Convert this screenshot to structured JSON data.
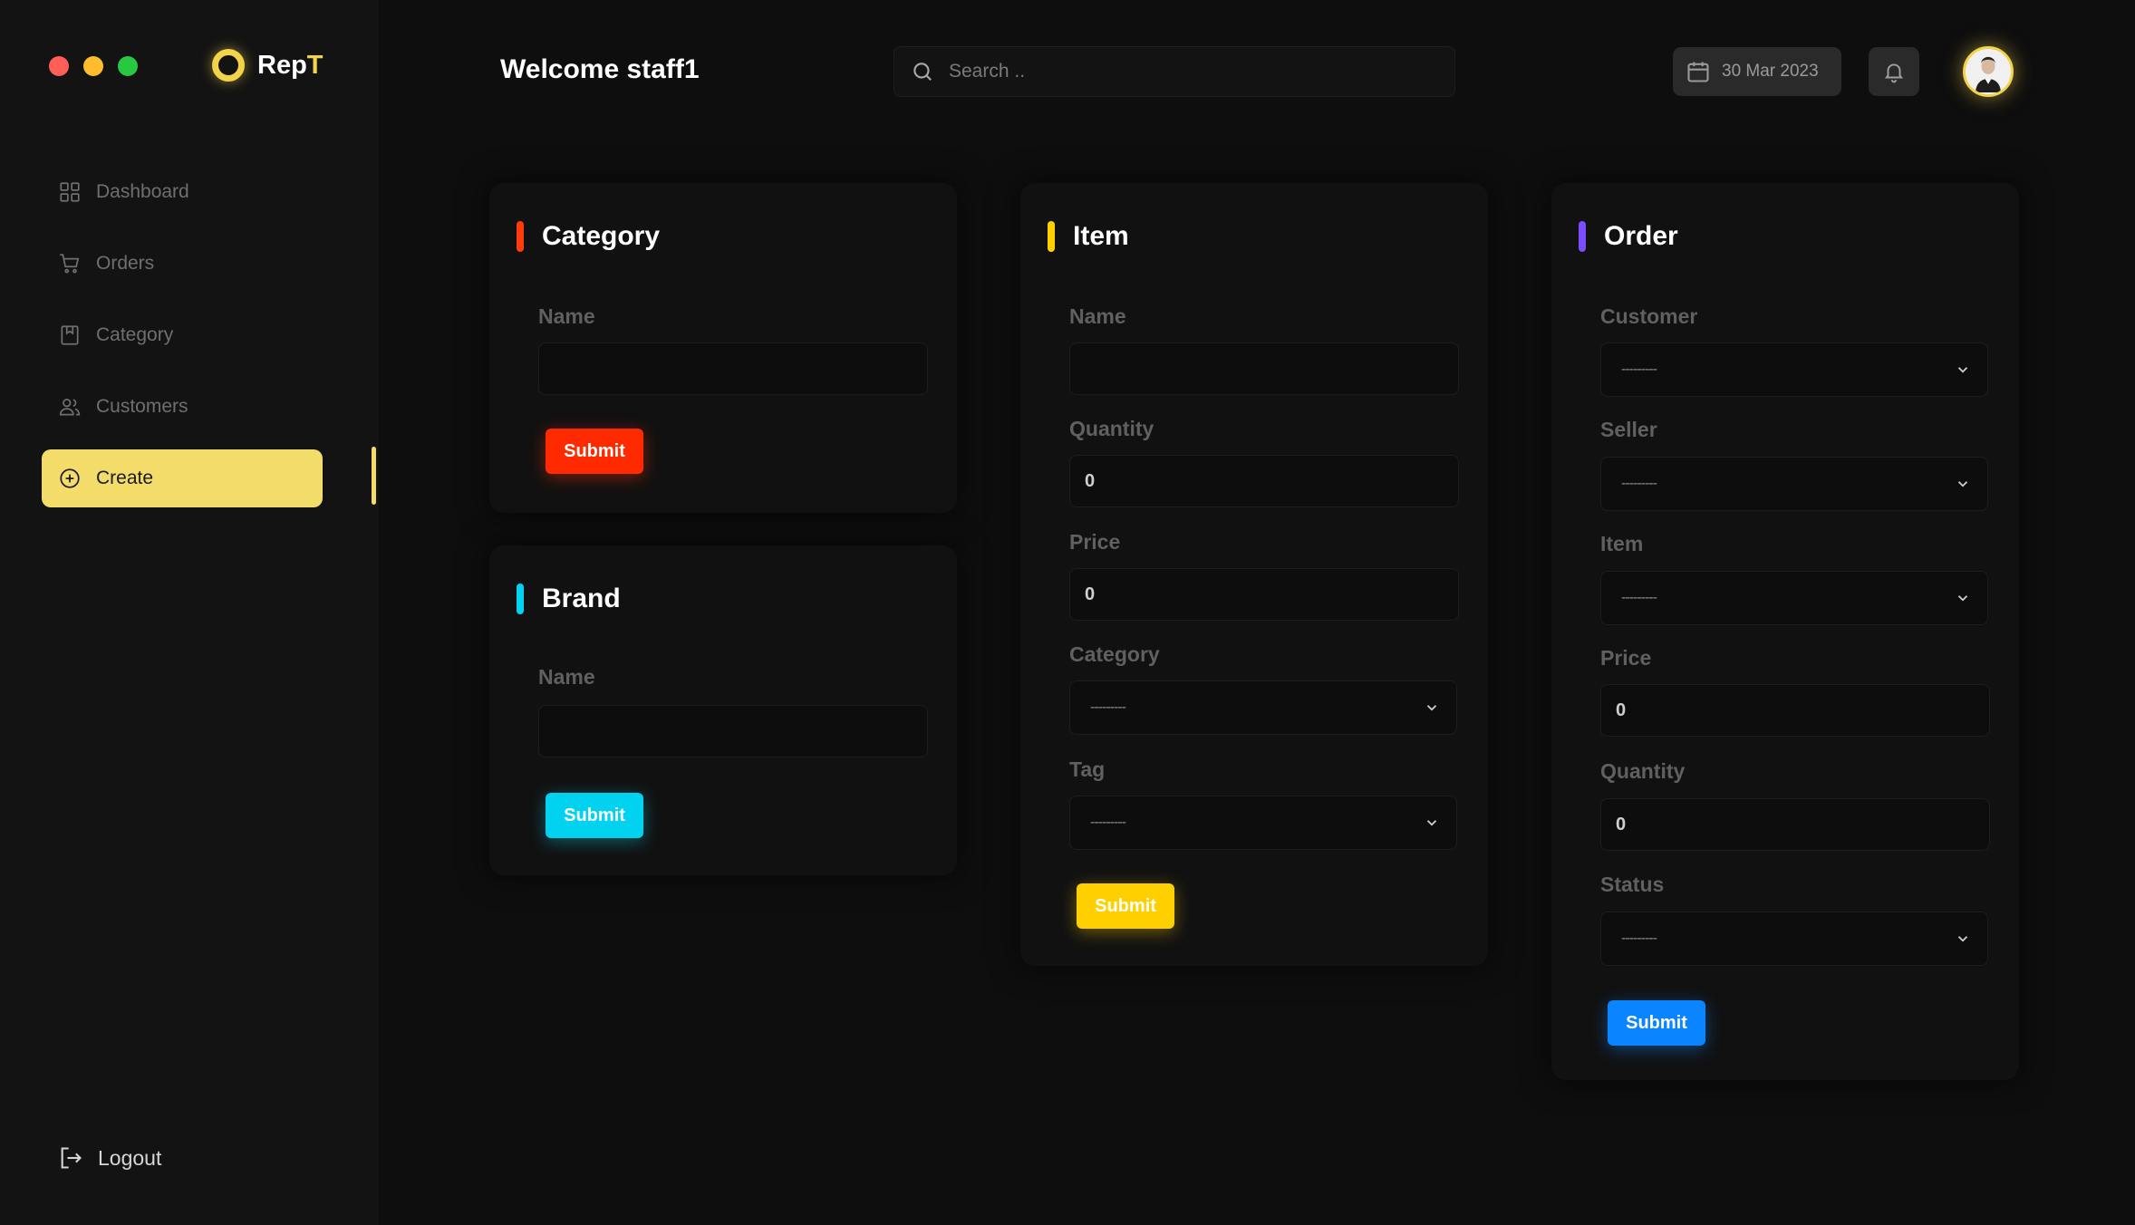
{
  "app": {
    "name_main": "Rep",
    "name_accent": "T"
  },
  "sidebar": {
    "items": [
      {
        "label": "Dashboard",
        "icon": "grid-icon"
      },
      {
        "label": "Orders",
        "icon": "cart-icon"
      },
      {
        "label": "Category",
        "icon": "bookmark-icon"
      },
      {
        "label": "Customers",
        "icon": "users-icon"
      },
      {
        "label": "Create",
        "icon": "plus-circle-icon",
        "active": true
      }
    ],
    "logout_label": "Logout"
  },
  "header": {
    "welcome": "Welcome staff1",
    "search_placeholder": "Search ..",
    "date": "30 Mar 2023"
  },
  "colors": {
    "accent": "#f4dc6b",
    "category": "#ff3b0a",
    "brand": "#00d2f0",
    "item": "#ffd000",
    "order": "#7b4dff",
    "order_button": "#0a84ff"
  },
  "forms": {
    "category": {
      "title": "Category",
      "name_label": "Name",
      "name_value": "",
      "submit": "Submit"
    },
    "brand": {
      "title": "Brand",
      "name_label": "Name",
      "name_value": "",
      "submit": "Submit"
    },
    "item": {
      "title": "Item",
      "name_label": "Name",
      "name_value": "",
      "quantity_label": "Quantity",
      "quantity_value": "0",
      "price_label": "Price",
      "price_value": "0",
      "category_label": "Category",
      "category_value": "---------",
      "tag_label": "Tag",
      "tag_value": "---------",
      "submit": "Submit"
    },
    "order": {
      "title": "Order",
      "customer_label": "Customer",
      "customer_value": "---------",
      "seller_label": "Seller",
      "seller_value": "---------",
      "item_label": "Item",
      "item_value": "---------",
      "price_label": "Price",
      "price_value": "0",
      "quantity_label": "Quantity",
      "quantity_value": "0",
      "status_label": "Status",
      "status_value": "---------",
      "submit": "Submit"
    }
  }
}
